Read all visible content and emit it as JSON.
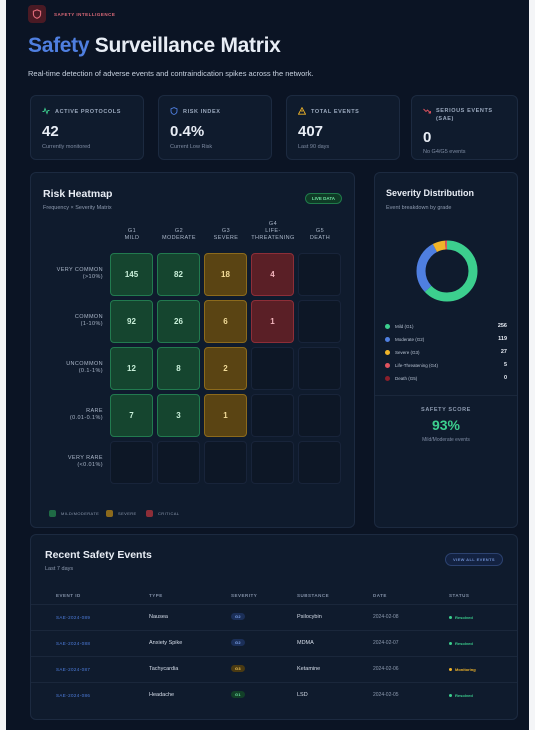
{
  "brand": {
    "label": "SAFETY INTELLIGENCE"
  },
  "header": {
    "title_accent": "Safety",
    "title_rest": "Surveillance Matrix",
    "subtitle": "Real-time detection of adverse events and contraindication spikes across the network."
  },
  "stats": [
    {
      "label": "ACTIVE PROTOCOLS",
      "value": "42",
      "sub": "Currently monitored",
      "icon": "activity-icon",
      "color": "#3ccf8e"
    },
    {
      "label": "RISK INDEX",
      "value": "0.4%",
      "sub": "Current Low Risk",
      "icon": "shield-icon",
      "color": "#4f7fe0"
    },
    {
      "label": "TOTAL EVENTS",
      "value": "407",
      "sub": "Last 90 days",
      "icon": "warning-icon",
      "color": "#f0b429"
    },
    {
      "label": "SERIOUS EVENTS (SAE)",
      "value": "0",
      "sub": "No G4/G5 events",
      "icon": "trend-down-icon",
      "color": "#e0525e"
    }
  ],
  "heatmap": {
    "title": "Risk Heatmap",
    "subtitle": "Frequency × Severity Matrix",
    "badge": "LIVE DATA",
    "columns": [
      {
        "code": "G1",
        "name": "MILD"
      },
      {
        "code": "G2",
        "name": "MODERATE"
      },
      {
        "code": "G3",
        "name": "SEVERE"
      },
      {
        "code": "G4",
        "name": "LIFE-THREATENING"
      },
      {
        "code": "G5",
        "name": "DEATH"
      }
    ],
    "rows": [
      {
        "name": "VERY COMMON",
        "range": "(>10%)",
        "cells": [
          "145",
          "82",
          "18",
          "4",
          ""
        ]
      },
      {
        "name": "COMMON",
        "range": "(1-10%)",
        "cells": [
          "92",
          "26",
          "6",
          "1",
          ""
        ]
      },
      {
        "name": "UNCOMMON",
        "range": "(0.1-1%)",
        "cells": [
          "12",
          "8",
          "2",
          "",
          ""
        ]
      },
      {
        "name": "RARE",
        "range": "(0.01-0.1%)",
        "cells": [
          "7",
          "3",
          "1",
          "",
          ""
        ]
      },
      {
        "name": "VERY RARE",
        "range": "(<0.01%)",
        "cells": [
          "",
          "",
          "",
          "",
          ""
        ]
      }
    ],
    "legend": [
      {
        "label": "MILD/MODERATE",
        "color": "#1f6b45"
      },
      {
        "label": "SEVERE",
        "color": "#8c6a1c"
      },
      {
        "label": "CRITICAL",
        "color": "#8d2e38"
      }
    ]
  },
  "severity": {
    "title": "Severity Distribution",
    "subtitle": "Event breakdown by grade",
    "items": [
      {
        "label": "Mild (G1)",
        "count": 256,
        "color": "#3ccf8e"
      },
      {
        "label": "Moderate (G2)",
        "count": 119,
        "color": "#4f7fe0"
      },
      {
        "label": "Severe (G3)",
        "count": 27,
        "color": "#f0b429"
      },
      {
        "label": "Life-Threatening (G4)",
        "count": 5,
        "color": "#e0525e"
      },
      {
        "label": "Death (G5)",
        "count": 0,
        "color": "#8a1f2b"
      }
    ],
    "score_label": "SAFETY SCORE",
    "score_value": "93%",
    "score_sub": "Mild/Moderate events"
  },
  "events": {
    "title": "Recent Safety Events",
    "subtitle": "Last 7 days",
    "view_all": "VIEW ALL EVENTS",
    "columns": [
      "EVENT ID",
      "TYPE",
      "SEVERITY",
      "SUBSTANCE",
      "DATE",
      "STATUS"
    ],
    "rows": [
      {
        "id": "SAE-2024-089",
        "type": "Nausea",
        "severity": "G2",
        "substance": "Psilocybin",
        "date": "2024-02-08",
        "status": "Resolved"
      },
      {
        "id": "SAE-2024-088",
        "type": "Anxiety Spike",
        "severity": "G2",
        "substance": "MDMA",
        "date": "2024-02-07",
        "status": "Resolved"
      },
      {
        "id": "SAE-2024-087",
        "type": "Tachycardia",
        "severity": "G3",
        "substance": "Ketamine",
        "date": "2024-02-06",
        "status": "Monitoring"
      },
      {
        "id": "SAE-2024-086",
        "type": "Headache",
        "severity": "G1",
        "substance": "LSD",
        "date": "2024-02-05",
        "status": "Resolved"
      }
    ]
  }
}
